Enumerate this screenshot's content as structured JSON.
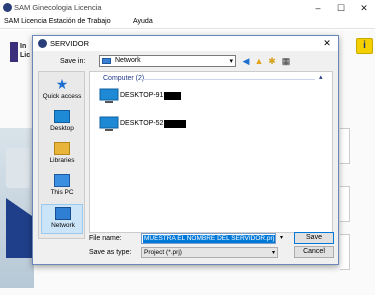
{
  "main_window": {
    "title": "SAM Ginecologia Licencia",
    "menu": [
      "SAM Licencia Estación de Trabajo",
      "Ayuda"
    ],
    "logo_text_1": "In",
    "logo_text_2": "Lic"
  },
  "dialog": {
    "title": "SERVIDOR",
    "save_in_label": "Save in:",
    "save_in_value": "Network",
    "places": [
      {
        "label": "Quick access",
        "icon": "star-icon"
      },
      {
        "label": "Desktop",
        "icon": "desktop-icon"
      },
      {
        "label": "Libraries",
        "icon": "libraries-icon"
      },
      {
        "label": "This PC",
        "icon": "computer-icon"
      },
      {
        "label": "Network",
        "icon": "network-icon"
      }
    ],
    "group_header": "Computer (2)",
    "computers": [
      {
        "name": "DESKTOP-919"
      },
      {
        "name": "DESKTOP-52D"
      }
    ],
    "file_name_label": "File name:",
    "file_name_value": "MUESTRA EL NOMBRE DEL SERVIDOR.prj",
    "save_type_label": "Save as type:",
    "save_type_value": "Project (*.prj)",
    "save_button": "Save",
    "cancel_button": "Cancel"
  }
}
